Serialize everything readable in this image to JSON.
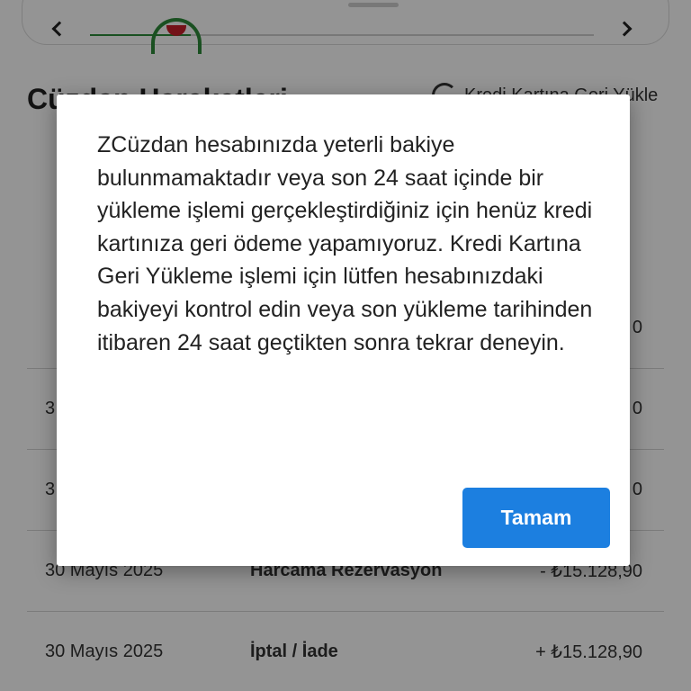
{
  "background": {
    "section_title": "Cüzdan Hareketleri",
    "reload_label": "Kredi Kartına Geri Yükle",
    "progress_fraction": 0.2,
    "transactions": [
      {
        "date": "",
        "type": "",
        "amount": "0"
      },
      {
        "date": "3",
        "type": "",
        "amount": "0"
      },
      {
        "date": "3",
        "type": "",
        "amount": "0"
      },
      {
        "date": "30 Mayıs 2025",
        "type": "Harcama Rezervasyon",
        "amount": "- ₺15.128,90"
      },
      {
        "date": "30 Mayıs 2025",
        "type": "İptal / İade",
        "amount": "+ ₺15.128,90"
      }
    ]
  },
  "dialog": {
    "message": "ZCüzdan hesabınızda yeterli bakiye bulunmamaktadır veya son 24 saat içinde bir yükleme işlemi gerçekleştirdiğiniz için henüz kredi kartınıza geri ödeme yapamıyoruz. Kredi Kartına Geri Yükleme işlemi için lütfen hesabınızdaki bakiyeyi kontrol edin veya son yükleme tarihinden itibaren 24 saat geçtikten sonra tekrar deneyin.",
    "ok_label": "Tamam"
  },
  "colors": {
    "accent": "#1c7fe0",
    "scrim": "rgba(0,0,0,0.42)",
    "brand_green": "#2e8b3a",
    "brand_red": "#c7202a"
  }
}
